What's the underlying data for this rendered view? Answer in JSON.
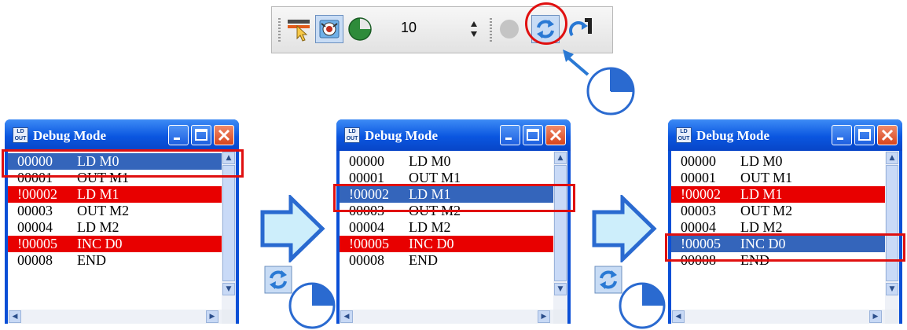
{
  "toolbar": {
    "interval_value": "10",
    "icons": [
      "step-cursor-icon",
      "monitor-eye-icon",
      "status-circle-icon",
      "spinner-updown-icon",
      "gray-circle-icon",
      "refresh-icon",
      "step-over-icon"
    ]
  },
  "windows": [
    {
      "title": "Debug Mode",
      "selected_row": 0,
      "rows": [
        {
          "addr": "00000",
          "ins": "LD M0",
          "state": "selected"
        },
        {
          "addr": "00001",
          "ins": "OUT M1",
          "state": "normal"
        },
        {
          "addr": "!00002",
          "ins": "LD M1",
          "state": "breakpoint"
        },
        {
          "addr": "00003",
          "ins": "OUT M2",
          "state": "normal"
        },
        {
          "addr": "00004",
          "ins": "LD M2",
          "state": "normal"
        },
        {
          "addr": "!00005",
          "ins": "INC D0",
          "state": "breakpoint"
        },
        {
          "addr": "00008",
          "ins": "END",
          "state": "normal"
        }
      ]
    },
    {
      "title": "Debug Mode",
      "selected_row": 2,
      "rows": [
        {
          "addr": "00000",
          "ins": "LD M0",
          "state": "normal"
        },
        {
          "addr": "00001",
          "ins": "OUT M1",
          "state": "normal"
        },
        {
          "addr": "!00002",
          "ins": "LD M1",
          "state": "selected"
        },
        {
          "addr": "00003",
          "ins": "OUT M2",
          "state": "normal"
        },
        {
          "addr": "00004",
          "ins": "LD M2",
          "state": "normal"
        },
        {
          "addr": "!00005",
          "ins": "INC D0",
          "state": "breakpoint"
        },
        {
          "addr": "00008",
          "ins": "END",
          "state": "normal"
        }
      ]
    },
    {
      "title": "Debug Mode",
      "selected_row": 5,
      "rows": [
        {
          "addr": "00000",
          "ins": "LD M0",
          "state": "normal"
        },
        {
          "addr": "00001",
          "ins": "OUT M1",
          "state": "normal"
        },
        {
          "addr": "!00002",
          "ins": "LD M1",
          "state": "breakpoint"
        },
        {
          "addr": "00003",
          "ins": "OUT M2",
          "state": "normal"
        },
        {
          "addr": "00004",
          "ins": "LD M2",
          "state": "normal"
        },
        {
          "addr": "!00005",
          "ins": "INC D0",
          "state": "selected"
        },
        {
          "addr": "00008",
          "ins": "END",
          "state": "normal"
        }
      ]
    }
  ],
  "colors": {
    "selected_bg": "#3465bb",
    "breakpoint_bg": "#e80000",
    "highlight": "#e01010",
    "arrow_fill": "#cdeefb",
    "arrow_stroke": "#2a6ad0"
  }
}
